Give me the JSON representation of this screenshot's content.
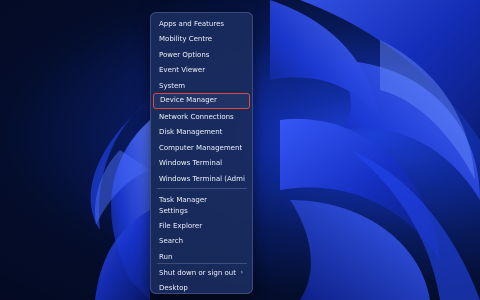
{
  "menu": {
    "items": [
      {
        "label": "Apps and Features"
      },
      {
        "label": "Mobility Centre"
      },
      {
        "label": "Power Options"
      },
      {
        "label": "Event Viewer"
      },
      {
        "label": "System"
      },
      {
        "label": "Device Manager"
      },
      {
        "label": "Network Connections"
      },
      {
        "label": "Disk Management"
      },
      {
        "label": "Computer Management"
      },
      {
        "label": "Windows Terminal"
      },
      {
        "label": "Windows Terminal (Admin)"
      },
      {
        "label": "Task Manager"
      },
      {
        "label": "Settings"
      },
      {
        "label": "File Explorer"
      },
      {
        "label": "Search"
      },
      {
        "label": "Run"
      },
      {
        "label": "Shut down or sign out"
      },
      {
        "label": "Desktop"
      }
    ],
    "submenu_arrow": "›",
    "highlight_color": "#e0483e",
    "background_color": "#1a2c5c"
  },
  "wallpaper": {
    "accent": "#2a4cff",
    "deep": "#0a1a70"
  }
}
